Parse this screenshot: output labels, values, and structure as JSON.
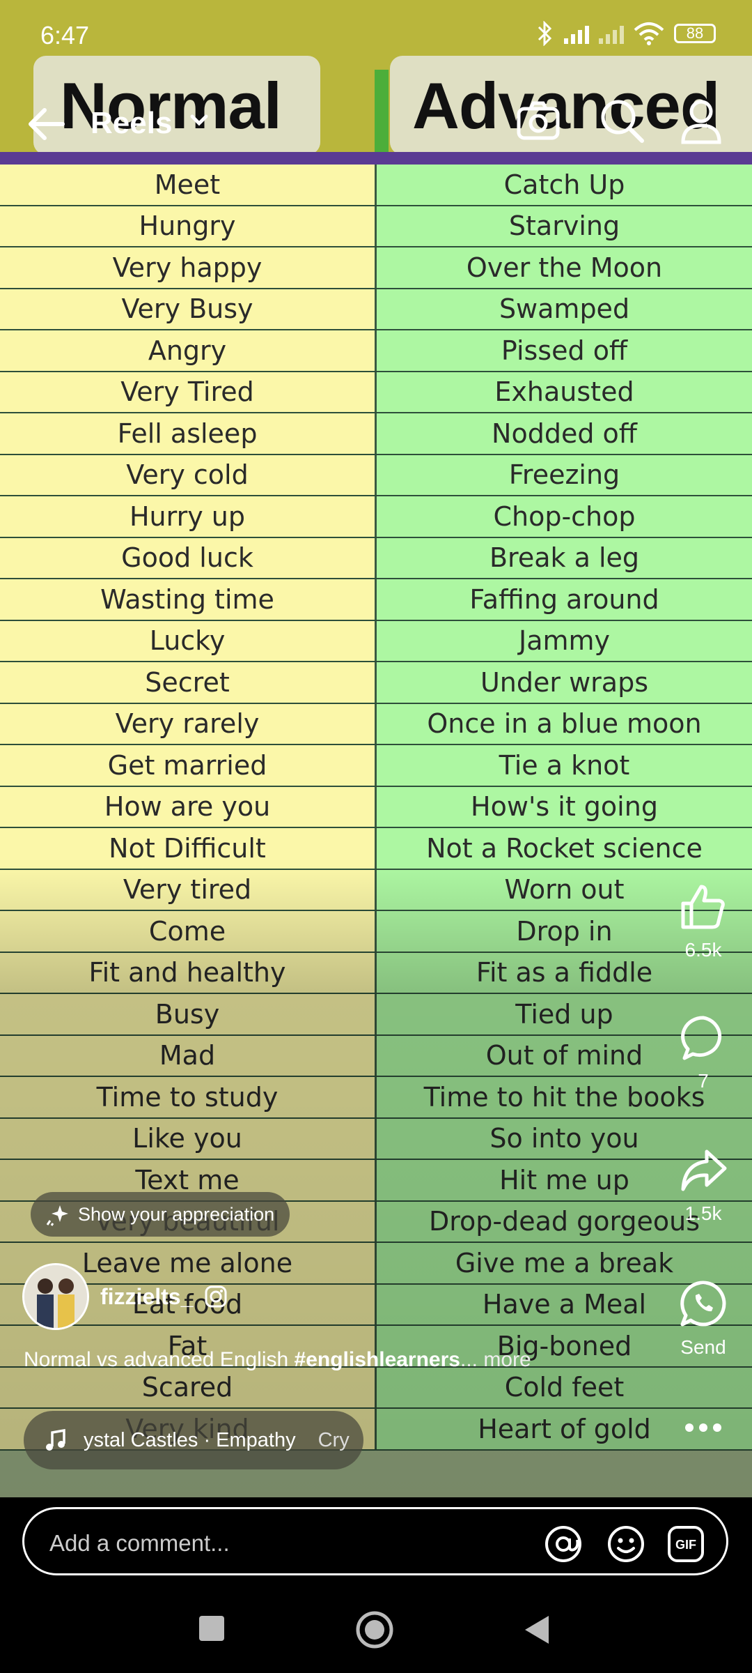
{
  "status_bar": {
    "time": "6:47",
    "battery": "88"
  },
  "nav": {
    "title": "Reels"
  },
  "video": {
    "header_left": "Normal",
    "header_right": "Advanced",
    "rows": [
      [
        "Meet",
        "Catch Up"
      ],
      [
        "Hungry",
        "Starving"
      ],
      [
        "Very happy",
        "Over the Moon"
      ],
      [
        "Very Busy",
        "Swamped"
      ],
      [
        "Angry",
        "Pissed off"
      ],
      [
        "Very Tired",
        "Exhausted"
      ],
      [
        "Fell asleep",
        "Nodded off"
      ],
      [
        "Very cold",
        "Freezing"
      ],
      [
        "Hurry up",
        "Chop-chop"
      ],
      [
        "Good luck",
        "Break a leg"
      ],
      [
        "Wasting time",
        "Faffing around"
      ],
      [
        "Lucky",
        "Jammy"
      ],
      [
        "Secret",
        "Under wraps"
      ],
      [
        "Very rarely",
        "Once in a blue moon"
      ],
      [
        "Get married",
        "Tie a knot"
      ],
      [
        "How are you",
        "How's it going"
      ],
      [
        "Not Difficult",
        "Not a Rocket science"
      ],
      [
        "Very tired",
        "Worn out"
      ],
      [
        "Come",
        "Drop in"
      ],
      [
        "Fit and healthy",
        "Fit as a fiddle"
      ],
      [
        "Busy",
        "Tied up"
      ],
      [
        "Mad",
        "Out of mind"
      ],
      [
        "Time to study",
        "Time to hit the books"
      ],
      [
        "Like you",
        "So into you"
      ],
      [
        "Text me",
        "Hit me up"
      ],
      [
        "Very beautiful",
        "Drop-dead gorgeous"
      ],
      [
        "Leave me alone",
        "Give me a break"
      ],
      [
        "Eat food",
        "Have a Meal"
      ],
      [
        "Fat",
        "Big-boned"
      ],
      [
        "Scared",
        "Cold feet"
      ],
      [
        "Very kind",
        "Heart of gold"
      ]
    ]
  },
  "actions": {
    "like_count": "6.5k",
    "comment_count": "7",
    "share_count": "1.5k",
    "send_label": "Send"
  },
  "overlay": {
    "appreciation": "Show your appreciation",
    "username": "fizzielts_",
    "caption_text": "Normal vs advanced English ",
    "caption_hashtag": "#englishlearners",
    "caption_more": "... more",
    "music_track": "ystal Castles · Empathy",
    "music_track2": "Cry"
  },
  "comment": {
    "placeholder": "Add a comment..."
  },
  "colors": {
    "normal_col": "#fbf7a9",
    "advanced_col": "#adf7a2",
    "header_band": "#b9b63c",
    "divider": "#5a3b93"
  },
  "icons": [
    "back-arrow-icon",
    "chevron-down-icon",
    "camera-icon",
    "search-icon",
    "profile-icon",
    "like-icon",
    "comment-icon",
    "share-icon",
    "whatsapp-icon",
    "more-icon",
    "music-note-icon",
    "sparkle-icon",
    "instagram-icon",
    "at-icon",
    "emoji-icon",
    "gif-icon",
    "square-nav-icon",
    "circle-nav-icon",
    "triangle-nav-icon"
  ]
}
